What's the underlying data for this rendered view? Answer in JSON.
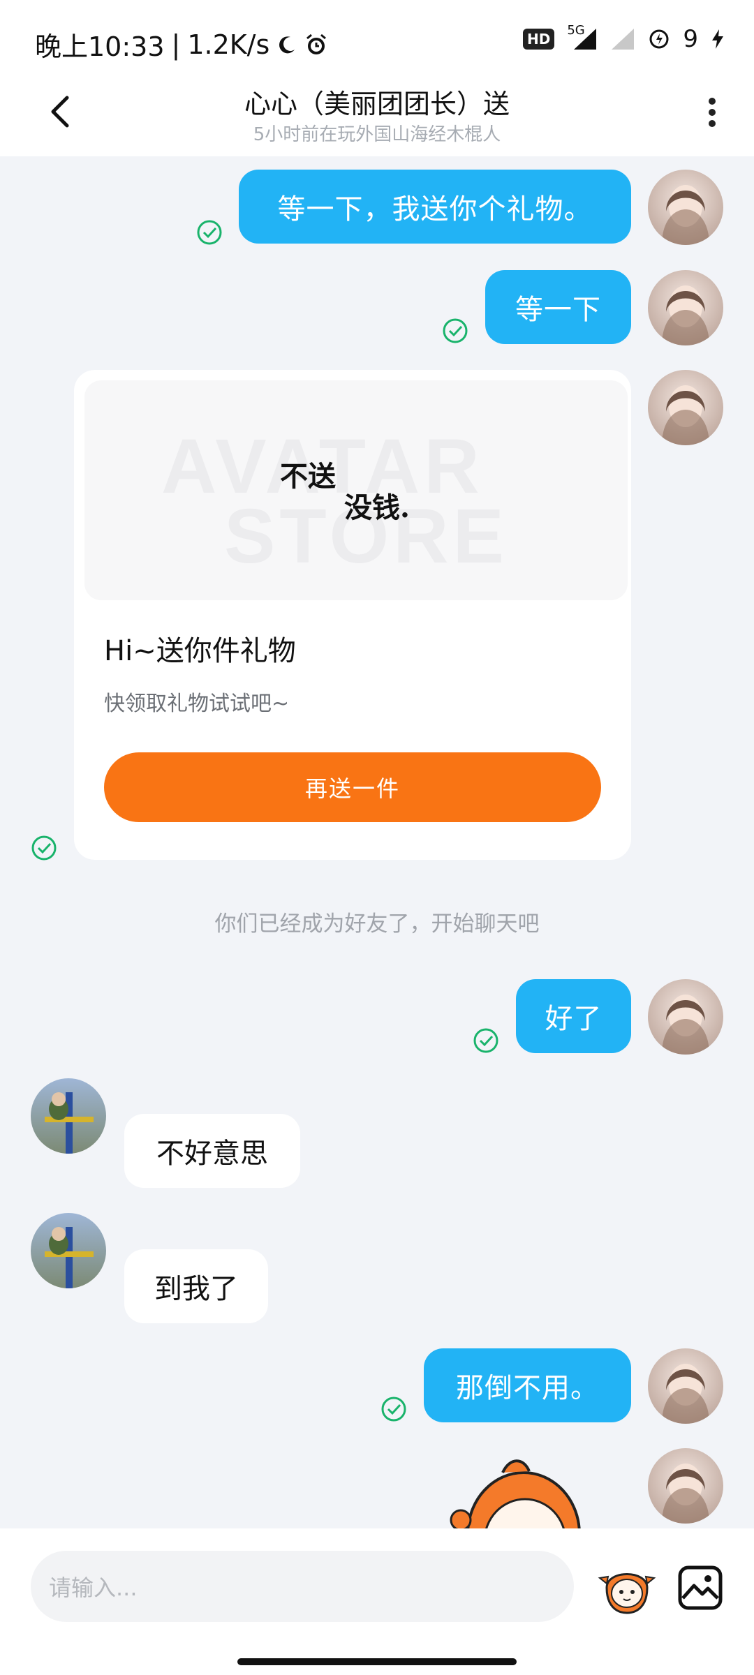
{
  "status_bar": {
    "time": "晚上10:33",
    "network_speed": "1.2K/s",
    "hd": "HD",
    "signal_label": "5G",
    "battery": "9"
  },
  "header": {
    "title": "心心（美丽团团长）送",
    "subtitle": "5小时前在玩外国山海经木棍人"
  },
  "messages": {
    "m1": "等一下，我送你个礼物。",
    "m2": "等一下",
    "m3": "好了",
    "m4": "不好意思",
    "m5": "到我了",
    "m6": "那倒不用。"
  },
  "gift_card": {
    "image_text_line1": "不送",
    "image_text_line2": "没钱.",
    "watermark_line1": "AVATAR",
    "watermark_line2": "STORE",
    "title": "Hi~送你件礼物",
    "desc": "快领取礼物试试吧~",
    "button": "再送一件"
  },
  "system_note": "你们已经成为好友了，开始聊天吧",
  "input": {
    "placeholder": "请输入..."
  },
  "colors": {
    "outgoing_bubble": "#22b3f5",
    "card_button": "#f97414",
    "read_check": "#19b36b"
  }
}
